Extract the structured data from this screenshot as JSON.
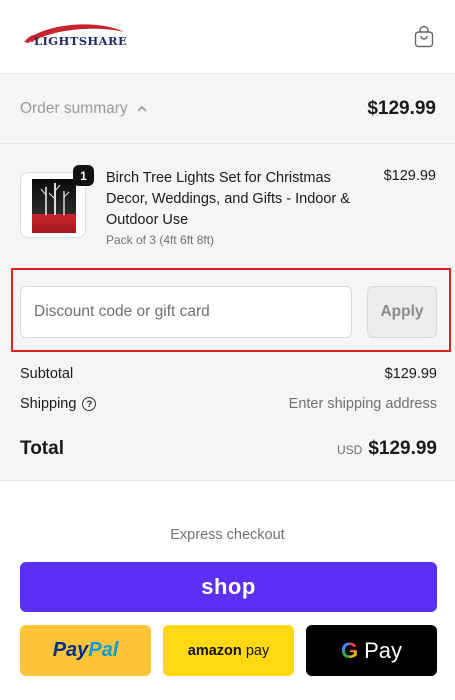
{
  "header": {
    "logo_text": "LIGHTSHARE",
    "cart_icon": "shopping-bag-icon"
  },
  "summary": {
    "toggle_label": "Order summary",
    "toggle_icon": "chevron-up-icon",
    "total": "$129.99"
  },
  "cart": {
    "items": [
      {
        "quantity": "1",
        "title": "Birch Tree Lights Set for Christmas Decor, Weddings, and Gifts - Indoor & Outdoor Use",
        "variant": "Pack of 3 (4ft 6ft 8ft)",
        "price": "$129.99"
      }
    ]
  },
  "discount": {
    "placeholder": "Discount code or gift card",
    "apply_label": "Apply",
    "highlight_color": "#e02020"
  },
  "totals": {
    "subtotal_label": "Subtotal",
    "subtotal_value": "$129.99",
    "shipping_label": "Shipping",
    "shipping_value": "Enter shipping address",
    "total_label": "Total",
    "currency": "USD",
    "total_value": "$129.99"
  },
  "express": {
    "title": "Express checkout",
    "shop_label": "shop",
    "paypal_part1": "Pay",
    "paypal_part2": "Pal",
    "amazon_part1": "amazon",
    "amazon_part2": "pay",
    "gpay_g": "G",
    "gpay_label": "Pay",
    "shop_color": "#5a31f4",
    "paypal_color": "#ffc439",
    "amazon_color": "#ffd814"
  }
}
